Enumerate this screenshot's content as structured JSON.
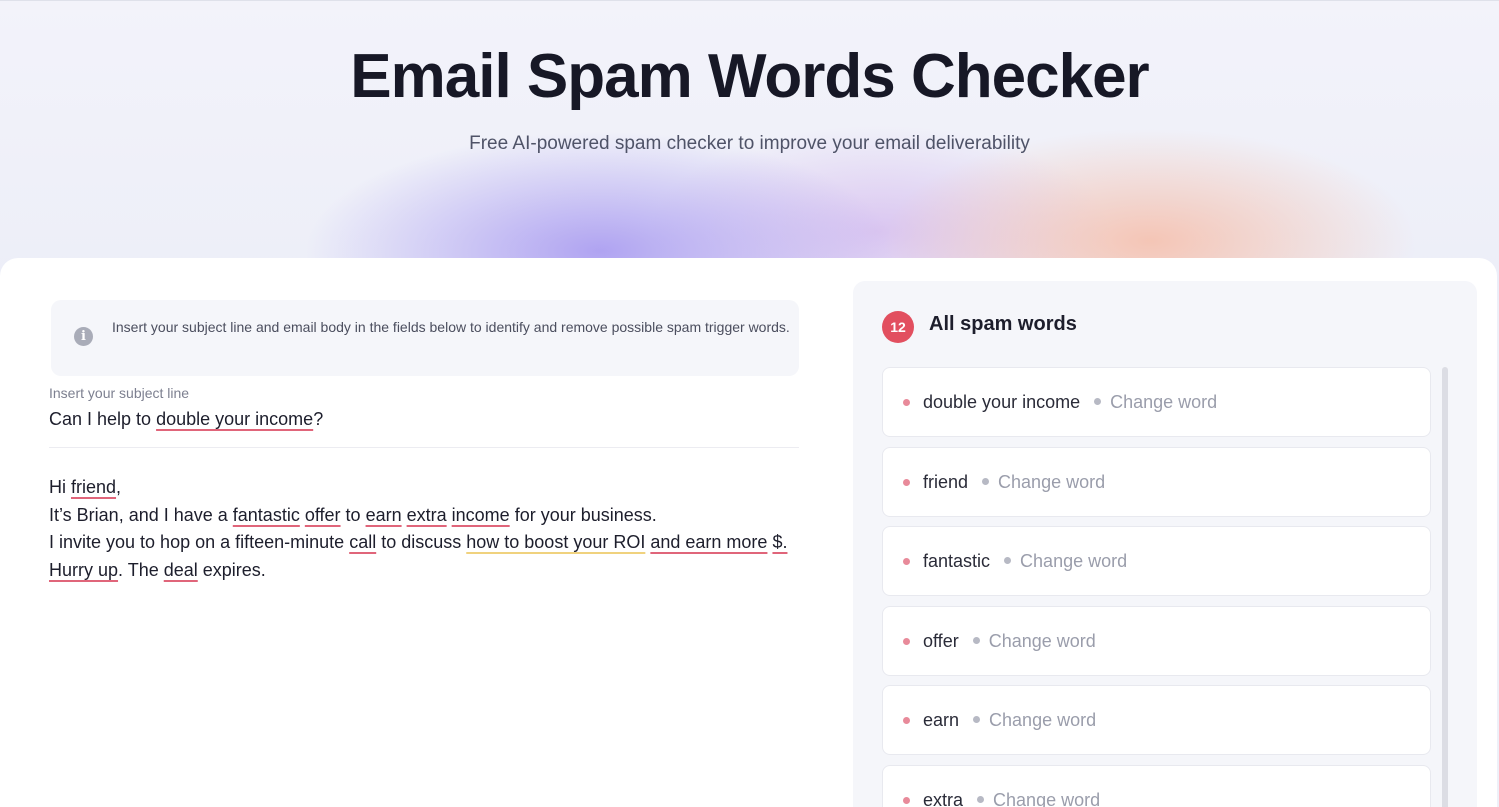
{
  "hero": {
    "title": "Email Spam Words Checker",
    "subtitle": "Free AI-powered spam checker to improve your email deliverability"
  },
  "info": {
    "icon": "info-icon",
    "text": "Insert your subject line and email body in the fields below to identify and remove possible spam trigger words."
  },
  "subject": {
    "label": "Insert your subject line",
    "prefix": "Can I help to ",
    "spam": "double your income",
    "suffix": "?"
  },
  "body": {
    "l1_a": "Hi ",
    "l1_friend": "friend",
    "l1_b": ",",
    "l2_a": "It’s Brian, and I have a ",
    "l2_fantastic": "fantastic",
    "l2_sp1": " ",
    "l2_offer": "offer",
    "l2_b": " to ",
    "l2_earn": "earn",
    "l2_sp2": " ",
    "l2_extra": "extra",
    "l2_sp3": " ",
    "l2_income": "income",
    "l2_c": " for your business.",
    "l3_a": "I invite you to hop on a fifteen-minute ",
    "l3_call": "call",
    "l3_b": " to discuss ",
    "l3_boost": "how to boost your ROI",
    "l3_sp": " ",
    "l3_earnmore": "and  earn more",
    "l3_sp2": " ",
    "l3_dollar": "$.",
    "l4_hurry": "Hurry up",
    "l4_a": ". The ",
    "l4_deal": "deal",
    "l4_b": " expires."
  },
  "panel": {
    "count": "12",
    "title": "All spam words",
    "change_label": "Change word",
    "items": [
      "double your income",
      "friend",
      "fantastic",
      "offer",
      "earn",
      "extra"
    ]
  },
  "colors": {
    "badge": "#e24f5f",
    "spam_underline": "#e0657a",
    "warning_underline": "#f0d27e"
  }
}
